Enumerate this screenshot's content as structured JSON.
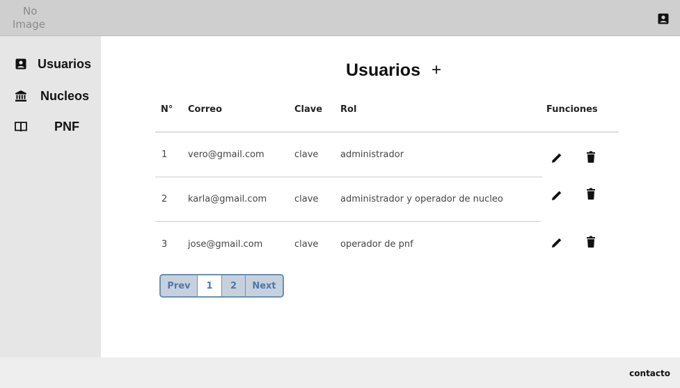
{
  "header": {
    "logo_line1": "No",
    "logo_line2": "Image"
  },
  "sidebar": {
    "items": [
      {
        "label": "Usuarios",
        "icon": "user-card-icon"
      },
      {
        "label": "Nucleos",
        "icon": "bank-icon"
      },
      {
        "label": "PNF",
        "icon": "book-icon"
      }
    ]
  },
  "main": {
    "title": "Usuarios",
    "add_symbol": "+",
    "columns": [
      "N°",
      "Correo",
      "Clave",
      "Rol",
      "Funciones"
    ],
    "rows": [
      {
        "n": "1",
        "correo": "vero@gmail.com",
        "clave": "clave",
        "rol": "administrador"
      },
      {
        "n": "2",
        "correo": "karla@gmail.com",
        "clave": "clave",
        "rol": "administrador y operador de nucleo"
      },
      {
        "n": "3",
        "correo": "jose@gmail.com",
        "clave": "clave",
        "rol": "operador de pnf"
      }
    ],
    "actions": {
      "edit_icon": "pencil-icon",
      "delete_icon": "trash-icon"
    }
  },
  "pagination": {
    "prev": "Prev",
    "pages": [
      "1",
      "2"
    ],
    "active_page": "1",
    "next": "Next"
  },
  "footer": {
    "contact": "contacto"
  }
}
